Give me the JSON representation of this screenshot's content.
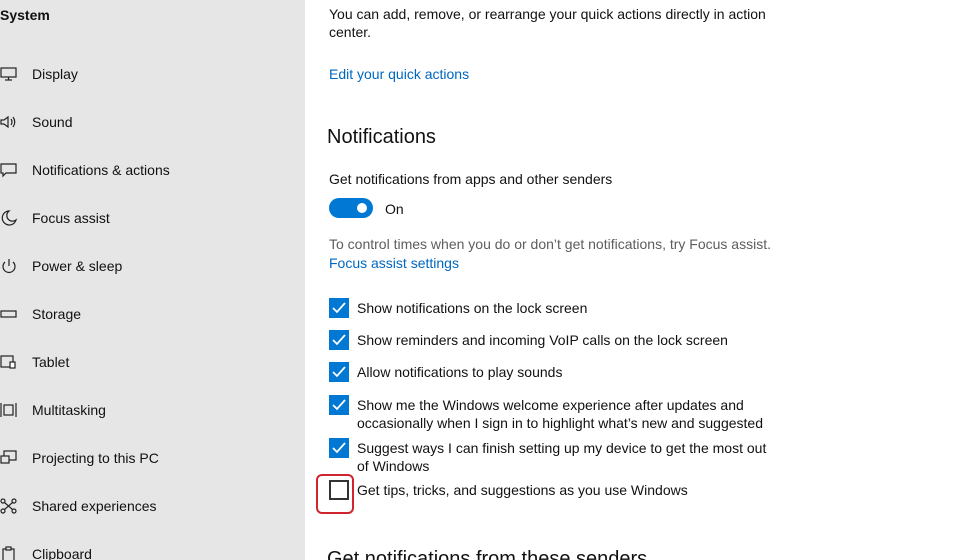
{
  "sidebar": {
    "title": "System",
    "items": [
      {
        "label": "Display",
        "icon": "monitor-icon"
      },
      {
        "label": "Sound",
        "icon": "speaker-icon"
      },
      {
        "label": "Notifications & actions",
        "icon": "message-icon"
      },
      {
        "label": "Focus assist",
        "icon": "moon-icon"
      },
      {
        "label": "Power & sleep",
        "icon": "power-icon"
      },
      {
        "label": "Storage",
        "icon": "drive-icon"
      },
      {
        "label": "Tablet",
        "icon": "tablet-icon"
      },
      {
        "label": "Multitasking",
        "icon": "multitasking-icon"
      },
      {
        "label": "Projecting to this PC",
        "icon": "project-icon"
      },
      {
        "label": "Shared experiences",
        "icon": "share-icon"
      },
      {
        "label": "Clipboard",
        "icon": "clipboard-icon"
      }
    ]
  },
  "main": {
    "quick_actions_desc": "You can add, remove, or rearrange your quick actions directly in action center.",
    "edit_quick_actions": "Edit your quick actions",
    "notifications_heading": "Notifications",
    "get_notifications_label": "Get notifications from apps and other senders",
    "toggle_state": "On",
    "focus_hint": "To control times when you do or don’t get notifications, try Focus assist.",
    "focus_link": "Focus assist settings",
    "checkboxes": [
      {
        "label": "Show notifications on the lock screen",
        "checked": true
      },
      {
        "label": "Show reminders and incoming VoIP calls on the lock screen",
        "checked": true
      },
      {
        "label": "Allow notifications to play sounds",
        "checked": true
      },
      {
        "label": "Show me the Windows welcome experience after updates and occasionally when I sign in to highlight what’s new and suggested",
        "checked": true
      },
      {
        "label": "Suggest ways I can finish setting up my device to get the most out of Windows",
        "checked": true
      },
      {
        "label": "Get tips, tricks, and suggestions as you use Windows",
        "checked": false
      }
    ],
    "next_heading_partial": "Get notifications from these senders"
  },
  "colors": {
    "accent": "#0078d4",
    "link": "#0067c0",
    "sidebar_bg": "#e6e6e6",
    "highlight": "#d0242f"
  }
}
